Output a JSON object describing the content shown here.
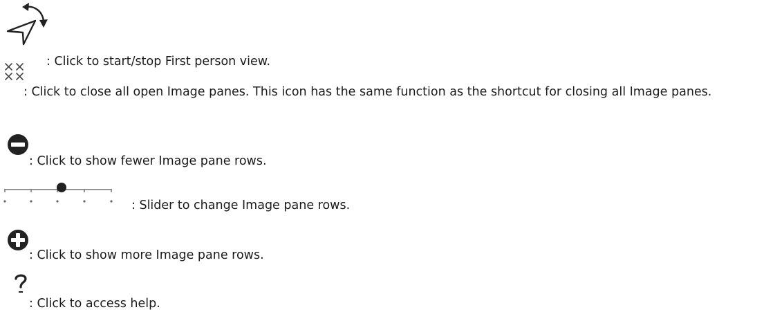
{
  "entries": [
    {
      "icon": "first-person-view-icon",
      "text": ": Click to start/stop First person view."
    },
    {
      "icon": "close-all-panes-icon",
      "text": ": Click to close all open Image panes. This icon has the same function as the shortcut for closing all Image panes."
    },
    {
      "icon": "minus-circle-icon",
      "text": ": Click to show fewer Image pane rows."
    },
    {
      "icon": "rows-slider-icon",
      "text": ": Slider to change Image pane rows."
    },
    {
      "icon": "plus-circle-icon",
      "text": ": Click to show more Image pane rows."
    },
    {
      "icon": "help-question-icon",
      "text": ": Click to access help."
    }
  ],
  "colors": {
    "text": "#1a1a1a",
    "icon": "#222222"
  }
}
